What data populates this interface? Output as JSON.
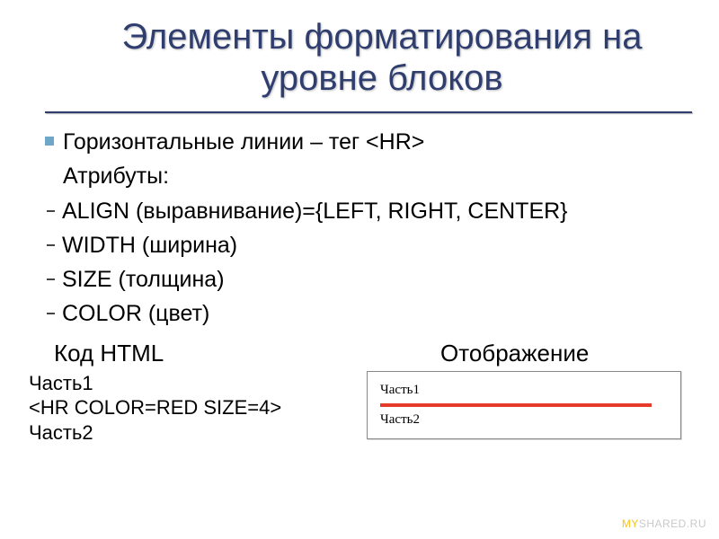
{
  "title": "Элементы форматирования на уровне блоков",
  "list": {
    "item1": "Горизонтальные линии – тег <HR>",
    "item2": "Атрибуты:",
    "sub1": "ALIGN (выравнивание)={LEFT, RIGHT, CENTER}",
    "sub2": "WIDTH (ширина)",
    "sub3": "SIZE (толщина)",
    "sub4": "COLOR (цвет)"
  },
  "cols": {
    "code_header": "Код HTML",
    "render_header": "Отображение",
    "code1": "Часть1",
    "code2": "<HR COLOR=RED SIZE=4>",
    "code3": "Часть2",
    "render1": "Часть1",
    "render2": "Часть2"
  },
  "watermark": {
    "left": "MY",
    "right": "SHARED.RU"
  },
  "colors": {
    "title": "#2f3e6e",
    "bullet": "#6fa7c8",
    "hr_red": "#e63a2a"
  }
}
